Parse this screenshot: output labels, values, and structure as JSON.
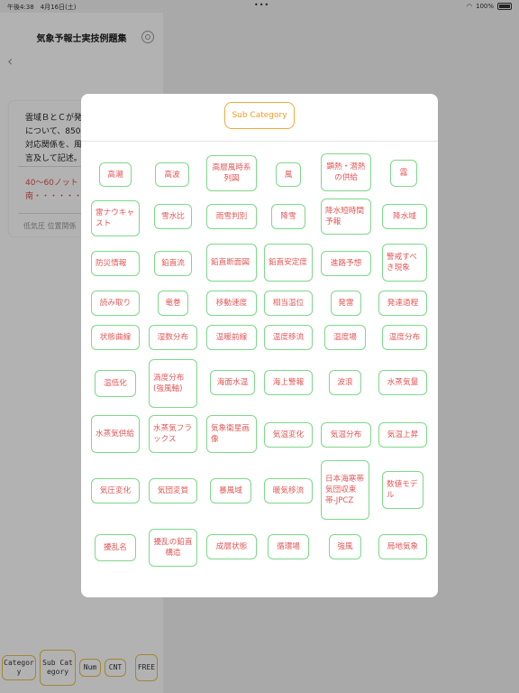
{
  "status_bar": {
    "time": "午後4:38　4月16日(土)",
    "dots": "•••",
    "wifi": "WiFi",
    "battery": "100%"
  },
  "app": {
    "title": "気象予報士実技例題集",
    "back": "‹",
    "question_text": "雲域ＢとＣが発\nについて、850\n対応関係を、風\n言及して記述。",
    "answer_text": "40〜60ノット\n南・・・・・・",
    "tags_text": "低気圧 位置関係"
  },
  "bottom_bar": {
    "category": "Category",
    "sub_category": "Sub Category",
    "num": "Num",
    "cnt": "CNT",
    "free": "FREE"
  },
  "modal": {
    "title_button": "Sub Category",
    "chips": [
      "高潮",
      "高波",
      "高層風時系列図",
      "風",
      "顕熱・潜熱の供給",
      "霧",
      "雷ナウキャスト",
      "雪水比",
      "雨雪判別",
      "降雪",
      "降水短時間予報",
      "降水域",
      "防災情報",
      "鉛直流",
      "鉛直断面図",
      "鉛直安定度",
      "進路予想",
      "警戒すべき現象",
      "読み取り",
      "竜巻",
      "移動速度",
      "相当温位",
      "発雷",
      "発達過程",
      "状態曲線",
      "湿数分布",
      "温暖前線",
      "温度移流",
      "温度場",
      "温度分布",
      "温低化",
      "渦度分布(強風軸)",
      "海面水温",
      "海上警報",
      "波浪",
      "水蒸気量",
      "水蒸気供給",
      "水蒸気フラックス",
      "気象衛星画像",
      "気温変化",
      "気温分布",
      "気温上昇",
      "気圧変化",
      "気団変質",
      "暴風域",
      "暖気移流",
      "日本海寒帯気団収束帯-JPCZ",
      "数値モデル",
      "擾乱名",
      "擾乱の鉛直構造",
      "成層状態",
      "循環場",
      "強風",
      "局地気象"
    ]
  },
  "colors": {
    "chip_border": "#7ed88a",
    "chip_text": "#e35757",
    "accent_orange": "#f2a93b",
    "bottom_border": "#e8c24a"
  }
}
